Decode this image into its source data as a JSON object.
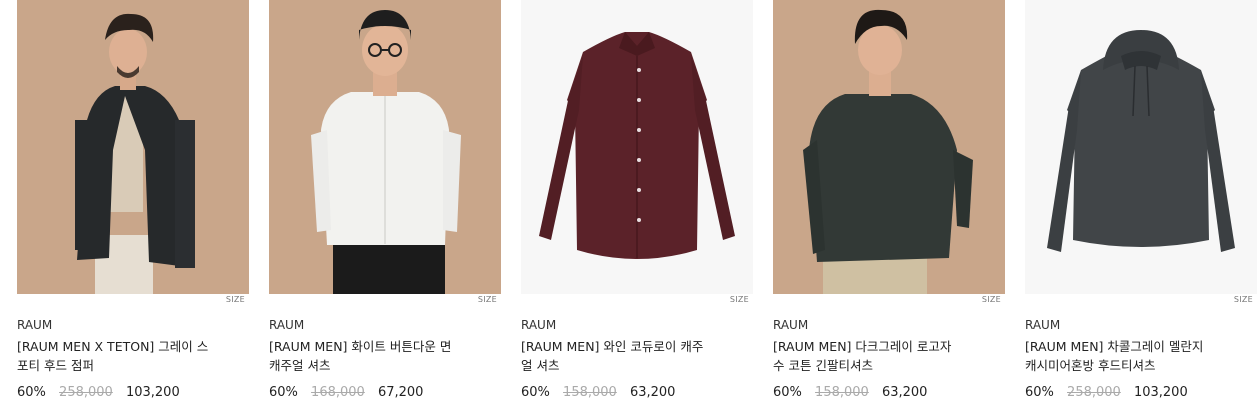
{
  "size_tag": "SIZE",
  "products": [
    {
      "brand": "RAUM",
      "name_line1": "[RAUM MEN X TETON] 그레이 스",
      "name_line2": "포티 후드 점퍼",
      "discount": "60%",
      "original_price": "258,000",
      "sale_price": "103,200",
      "image": "model wearing black hooded jacket",
      "bg_color": "#c9a68a"
    },
    {
      "brand": "RAUM",
      "name_line1": "[RAUM MEN] 화이트 버튼다운 면",
      "name_line2": "캐주얼 셔츠",
      "discount": "60%",
      "original_price": "168,000",
      "sale_price": "67,200",
      "image": "model wearing white button-down shirt",
      "bg_color": "#c9a68a"
    },
    {
      "brand": "RAUM",
      "name_line1": "[RAUM MEN] 와인 코듀로이 캐주",
      "name_line2": "얼 셔츠",
      "discount": "60%",
      "original_price": "158,000",
      "sale_price": "63,200",
      "image": "wine corduroy shirt flat lay",
      "bg_color": "#f7f7f7"
    },
    {
      "brand": "RAUM",
      "name_line1": "[RAUM MEN] 다크그레이 로고자",
      "name_line2": "수 코튼 긴팔티셔츠",
      "discount": "60%",
      "original_price": "158,000",
      "sale_price": "63,200",
      "image": "model wearing dark grey sweatshirt",
      "bg_color": "#c9a68a"
    },
    {
      "brand": "RAUM",
      "name_line1": "[RAUM MEN] 차콜그레이 멜란지",
      "name_line2": "캐시미어혼방 후드티셔츠",
      "discount": "60%",
      "original_price": "258,000",
      "sale_price": "103,200",
      "image": "charcoal grey hoodie flat lay",
      "bg_color": "#f7f7f7"
    }
  ]
}
